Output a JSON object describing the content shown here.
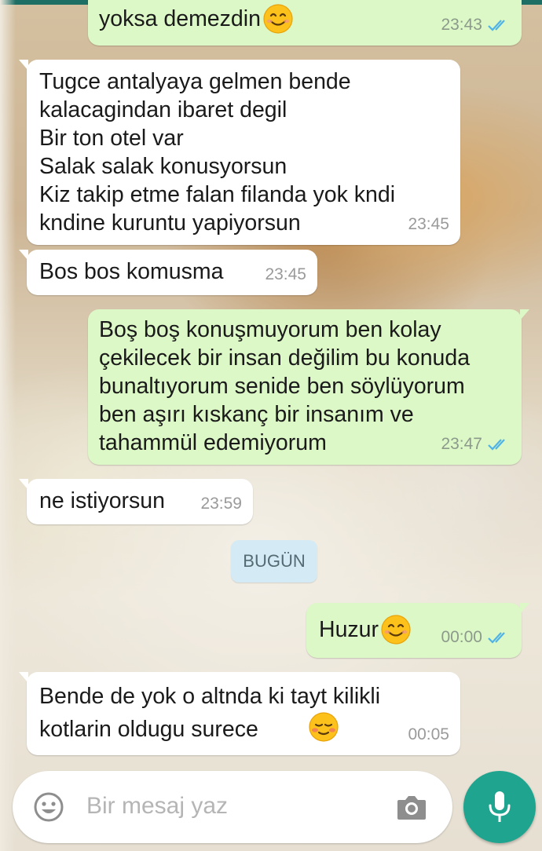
{
  "conversation": {
    "messages": [
      {
        "id": "m1",
        "direction": "out",
        "text": "yoksa demezdin",
        "time": "23:43",
        "emoji": "smiling-face-with-smiling-eyes",
        "status": "read"
      },
      {
        "id": "m2",
        "direction": "in",
        "text": "Tugce antalyaya gelmen bende\nkalacagindan ibaret degil\nBir ton otel var\nSalak salak konusyorsun\nKiz takip etme falan filanda yok kndi\nkndine kuruntu yapiyorsun",
        "time": "23:45"
      },
      {
        "id": "m3",
        "direction": "in",
        "text": "Bos bos komusma",
        "time": "23:45"
      },
      {
        "id": "m4",
        "direction": "out",
        "text": "Boş boş konuşmuyorum ben kolay\nçekilecek bir insan değilim bu konuda\nbunaltıyorum senide ben söylüyorum\nben aşırı kıskanç bir insanım ve\ntahammül edemiyorum",
        "time": "23:47",
        "status": "read"
      },
      {
        "id": "m5",
        "direction": "in",
        "text": "ne istiyorsun",
        "time": "23:59"
      },
      {
        "id": "m6",
        "direction": "out",
        "text": "Huzur ",
        "time": "00:00",
        "emoji": "smiling-face-with-smiling-eyes",
        "status": "read"
      },
      {
        "id": "m7",
        "direction": "in",
        "text": "Bende de yok o altnda ki tayt kilikli\nkotlarin oldugu surece",
        "time": "00:05",
        "emoji": "smiling-face-blushing"
      }
    ],
    "date_separator": "BUGÜN"
  },
  "composer": {
    "placeholder": "Bir mesaj yaz",
    "emoji_icon": "emoji-smiley-icon",
    "camera_icon": "camera-icon",
    "mic_icon": "microphone-icon"
  },
  "colors": {
    "incoming_bubble": "#ffffff",
    "outgoing_bubble": "#dcf8c6",
    "read_ticks": "#4fb3e8",
    "accent": "#1fa58f",
    "date_chip": "#d4ebf5"
  }
}
